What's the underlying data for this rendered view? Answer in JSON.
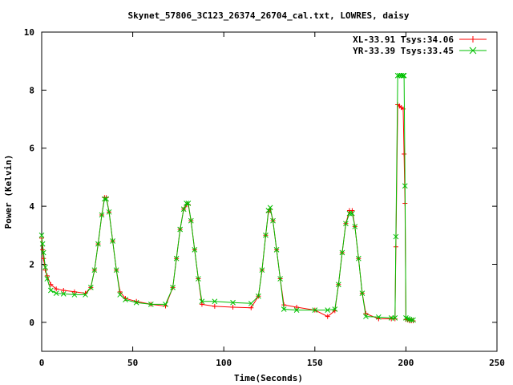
{
  "chart_data": {
    "type": "line",
    "title": "Skynet_57806_3C123_26374_26704_cal.txt, LOWRES, daisy",
    "xlabel": "Time(Seconds)",
    "ylabel": "Power (Kelvin)",
    "xlim": [
      0,
      250
    ],
    "ylim": [
      -1,
      10
    ],
    "xticks": [
      0,
      50,
      100,
      150,
      200,
      250
    ],
    "yticks": [
      0,
      2,
      4,
      6,
      8,
      10
    ],
    "xtick_labels": [
      "0",
      "50",
      "100",
      "150",
      "200",
      "250"
    ],
    "ytick_labels": [
      "0",
      "2",
      "4",
      "6",
      "8",
      "10"
    ],
    "grid": false,
    "legend_position": "top-right",
    "series": [
      {
        "name": "XL-33.91 Tsys:34.06",
        "color": "#ff0000",
        "marker": "plus",
        "x": [
          0,
          0.5,
          1,
          2,
          3,
          5,
          8,
          12,
          18,
          24,
          27,
          29,
          31,
          33,
          34.5,
          35.5,
          37,
          39,
          41,
          43,
          46,
          52,
          60,
          68,
          72,
          74,
          76,
          78,
          79.5,
          80.5,
          82,
          84,
          86,
          88,
          95,
          105,
          115,
          119,
          121,
          123,
          124.5,
          125.5,
          127,
          129,
          131,
          133,
          140,
          150,
          157,
          161,
          163,
          165,
          167,
          169,
          170.5,
          172,
          174,
          176,
          178,
          185,
          192,
          194,
          194.5,
          195.5,
          196.5,
          197.5,
          198.5,
          199,
          199.5,
          200,
          201,
          202,
          203,
          204
        ],
        "y": [
          2.9,
          2.5,
          2.2,
          1.8,
          1.6,
          1.3,
          1.15,
          1.1,
          1.05,
          1.0,
          1.2,
          1.8,
          2.7,
          3.7,
          4.3,
          4.3,
          3.8,
          2.8,
          1.8,
          1.05,
          0.82,
          0.72,
          0.62,
          0.56,
          1.2,
          2.2,
          3.2,
          3.9,
          4.05,
          4.05,
          3.5,
          2.5,
          1.5,
          0.62,
          0.55,
          0.52,
          0.5,
          0.9,
          1.8,
          3.0,
          3.8,
          3.9,
          3.5,
          2.5,
          1.5,
          0.6,
          0.52,
          0.42,
          0.2,
          0.4,
          1.3,
          2.4,
          3.4,
          3.85,
          3.85,
          3.3,
          2.2,
          1.0,
          0.3,
          0.12,
          0.12,
          0.12,
          2.6,
          7.5,
          7.45,
          7.4,
          7.35,
          5.8,
          4.1,
          0.1,
          0.08,
          0.05,
          0.05,
          0.05
        ]
      },
      {
        "name": "YR-33.39 Tsys:33.45",
        "color": "#00c000",
        "marker": "cross",
        "x": [
          0,
          0.5,
          1,
          2,
          3,
          5,
          8,
          12,
          18,
          24,
          27,
          29,
          31,
          33,
          34.5,
          35.5,
          37,
          39,
          41,
          43,
          46,
          52,
          60,
          68,
          72,
          74,
          76,
          78,
          79.5,
          80.5,
          82,
          84,
          86,
          88,
          95,
          105,
          115,
          119,
          121,
          123,
          124.5,
          125.5,
          127,
          129,
          131,
          133,
          140,
          150,
          157,
          161,
          163,
          165,
          167,
          169,
          170.5,
          172,
          174,
          176,
          178,
          185,
          192,
          194,
          194.5,
          195.5,
          196.5,
          197.5,
          198.5,
          199,
          199.5,
          200,
          201,
          202,
          203,
          204
        ],
        "y": [
          3.0,
          2.7,
          2.4,
          1.9,
          1.5,
          1.1,
          1.0,
          0.98,
          0.95,
          0.95,
          1.2,
          1.8,
          2.7,
          3.7,
          4.25,
          4.25,
          3.8,
          2.8,
          1.8,
          0.95,
          0.78,
          0.68,
          0.62,
          0.62,
          1.2,
          2.2,
          3.2,
          3.9,
          4.1,
          4.1,
          3.5,
          2.5,
          1.5,
          0.72,
          0.72,
          0.68,
          0.65,
          0.9,
          1.8,
          3.0,
          3.85,
          3.95,
          3.5,
          2.5,
          1.5,
          0.45,
          0.42,
          0.42,
          0.42,
          0.45,
          1.3,
          2.4,
          3.4,
          3.75,
          3.75,
          3.3,
          2.2,
          1.0,
          0.2,
          0.18,
          0.15,
          0.15,
          2.95,
          8.5,
          8.5,
          8.5,
          8.5,
          8.5,
          4.7,
          0.15,
          0.12,
          0.1,
          0.08,
          0.08
        ]
      }
    ]
  }
}
